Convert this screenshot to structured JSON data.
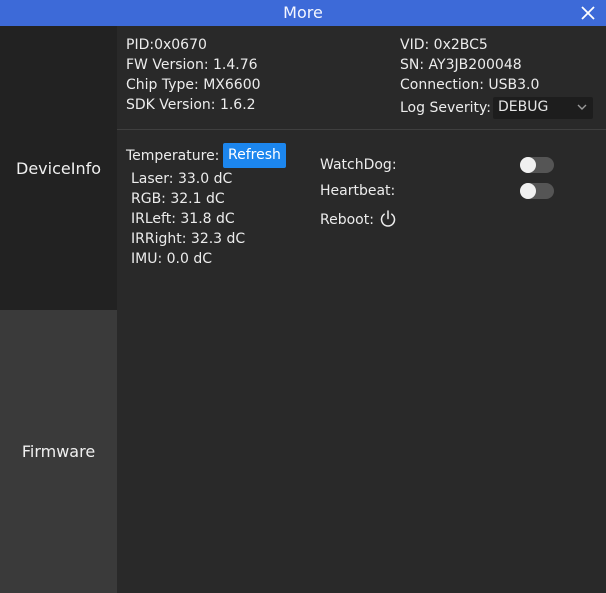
{
  "window": {
    "title": "More"
  },
  "sidebar": {
    "items": [
      {
        "label": "DeviceInfo",
        "selected": true
      },
      {
        "label": "Firmware",
        "selected": false
      }
    ]
  },
  "device": {
    "pid_label": "PID:",
    "pid": "0x0670",
    "fw_label": "FW Version:",
    "fw": "1.4.76",
    "chip_label": "Chip Type:",
    "chip": "MX6600",
    "sdk_label": "SDK Version:",
    "sdk": "1.6.2",
    "vid_label": "VID:",
    "vid": "0x2BC5",
    "sn_label": "SN:",
    "sn": "AY3JB200048",
    "conn_label": "Connection:",
    "conn": "USB3.0",
    "log_label": "Log Severity:",
    "log_value": "DEBUG"
  },
  "temperature": {
    "label": "Temperature:",
    "refresh_label": "Refresh",
    "items": [
      {
        "label": "Laser:",
        "value": "33.0 dC"
      },
      {
        "label": "RGB:",
        "value": "32.1 dC"
      },
      {
        "label": "IRLeft:",
        "value": "31.8 dC"
      },
      {
        "label": "IRRight:",
        "value": "32.3 dC"
      },
      {
        "label": "IMU:",
        "value": "0.0 dC"
      }
    ]
  },
  "controls": {
    "watchdog_label": "WatchDog:",
    "watchdog_on": false,
    "heartbeat_label": "Heartbeat:",
    "heartbeat_on": false,
    "reboot_label": "Reboot:"
  },
  "colors": {
    "titlebar": "#3d6ad8",
    "accent_button": "#1c86ee",
    "sidebar_selected": "#222222",
    "sidebar_unselected": "#3a3a3a",
    "panel": "#292929"
  },
  "icons": {
    "close": "close-icon",
    "dropdown": "chevron-down-icon",
    "power": "power-icon"
  }
}
